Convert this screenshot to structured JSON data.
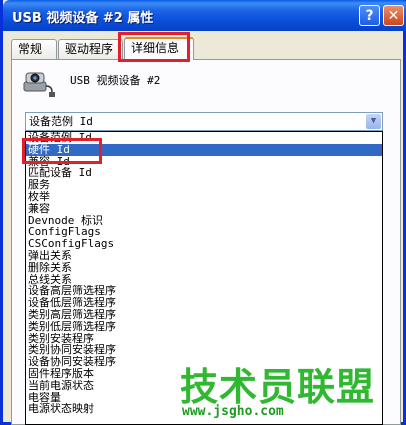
{
  "window": {
    "title": "USB 视频设备 #2 属性",
    "help_label": "?",
    "close_label": "✕"
  },
  "tabs": [
    {
      "label": "常规"
    },
    {
      "label": "驱动程序"
    },
    {
      "label": "详细信息"
    }
  ],
  "device": {
    "name": "USB 视频设备 #2",
    "icon": "webcam-icon"
  },
  "property_select": {
    "selected": "设备范例 Id"
  },
  "dropdown_options": [
    "设备范例 Id",
    "硬件 Id",
    "兼容 Id",
    "匹配设备 Id",
    "服务",
    "枚举",
    "兼容",
    "Devnode 标识",
    "ConfigFlags",
    "CSConfigFlags",
    "弹出关系",
    "删除关系",
    "总线关系",
    "设备高层筛选程序",
    "设备低层筛选程序",
    "类别高层筛选程序",
    "类别低层筛选程序",
    "类别安装程序",
    "类别协同安装程序",
    "设备协同安装程序",
    "固件程序版本",
    "当前电源状态",
    "电容量",
    "电源状态映射"
  ],
  "selected_index": 1,
  "watermark": {
    "title": "技术员联盟",
    "url": "www.jsgho.com"
  },
  "colors": {
    "titlebar": "#0a4ed8",
    "selection": "#316ac5",
    "highlight_box": "#e0202a",
    "watermark": "#2fb830"
  }
}
